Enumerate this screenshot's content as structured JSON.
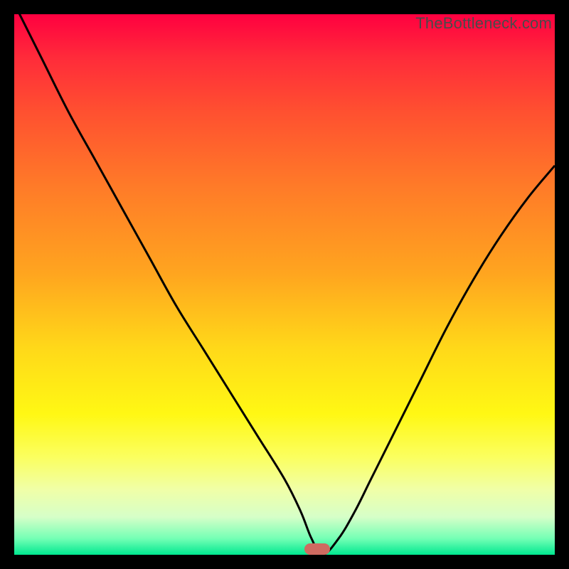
{
  "watermark": "TheBottleneck.com",
  "colors": {
    "frame": "#000000",
    "curve": "#000000",
    "marker": "#cf6b61",
    "gradient_top": "#ff0040",
    "gradient_bottom": "#00e890"
  },
  "chart_data": {
    "type": "line",
    "title": "",
    "xlabel": "",
    "ylabel": "",
    "xlim": [
      0,
      100
    ],
    "ylim": [
      0,
      100
    ],
    "series": [
      {
        "name": "bottleneck-curve",
        "x": [
          0,
          5,
          10,
          15,
          20,
          25,
          30,
          35,
          40,
          45,
          50,
          53,
          55,
          57,
          60,
          63,
          66,
          70,
          75,
          80,
          85,
          90,
          95,
          100
        ],
        "values": [
          102,
          92,
          82,
          73,
          64,
          55,
          46,
          38,
          30,
          22,
          14,
          8,
          3,
          0,
          3,
          8,
          14,
          22,
          32,
          42,
          51,
          59,
          66,
          72
        ]
      }
    ],
    "annotations": [
      {
        "name": "optimal-marker",
        "x": 56,
        "y": 1
      }
    ]
  }
}
